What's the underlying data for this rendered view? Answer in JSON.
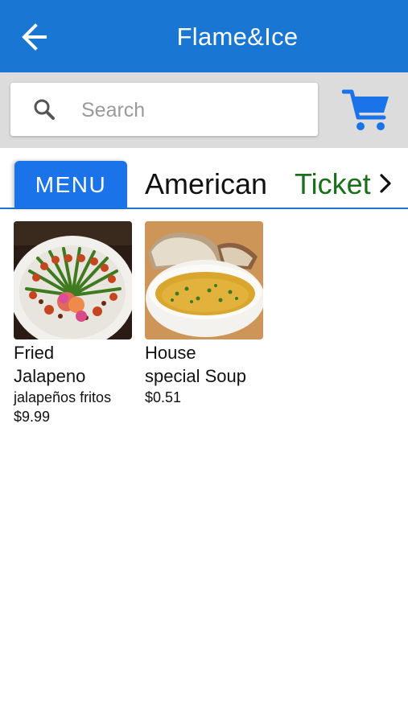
{
  "header": {
    "title": "Flame&Ice",
    "back_icon": "arrow-left-icon",
    "background_color": "#1976d2"
  },
  "search": {
    "placeholder": "Search",
    "value": "",
    "icon": "search-icon"
  },
  "cart": {
    "icon": "shopping-cart-icon",
    "color": "#1a73e8"
  },
  "tabs": [
    {
      "label": "MENU",
      "selected": true
    },
    {
      "label": "American",
      "selected": false
    },
    {
      "label": "Ticket",
      "selected": false,
      "icon": "chevron-right-icon"
    }
  ],
  "items": [
    {
      "name_line1": "Fried",
      "name_line2": "Jalapeno",
      "description": "jalapeños fritos",
      "price": "$9.99"
    },
    {
      "name_line1": "House",
      "name_line2": "special Soup",
      "description": "",
      "price": "$0.51"
    }
  ],
  "colors": {
    "accent": "#1a73e8",
    "ticket_text": "#1b6e1b"
  }
}
